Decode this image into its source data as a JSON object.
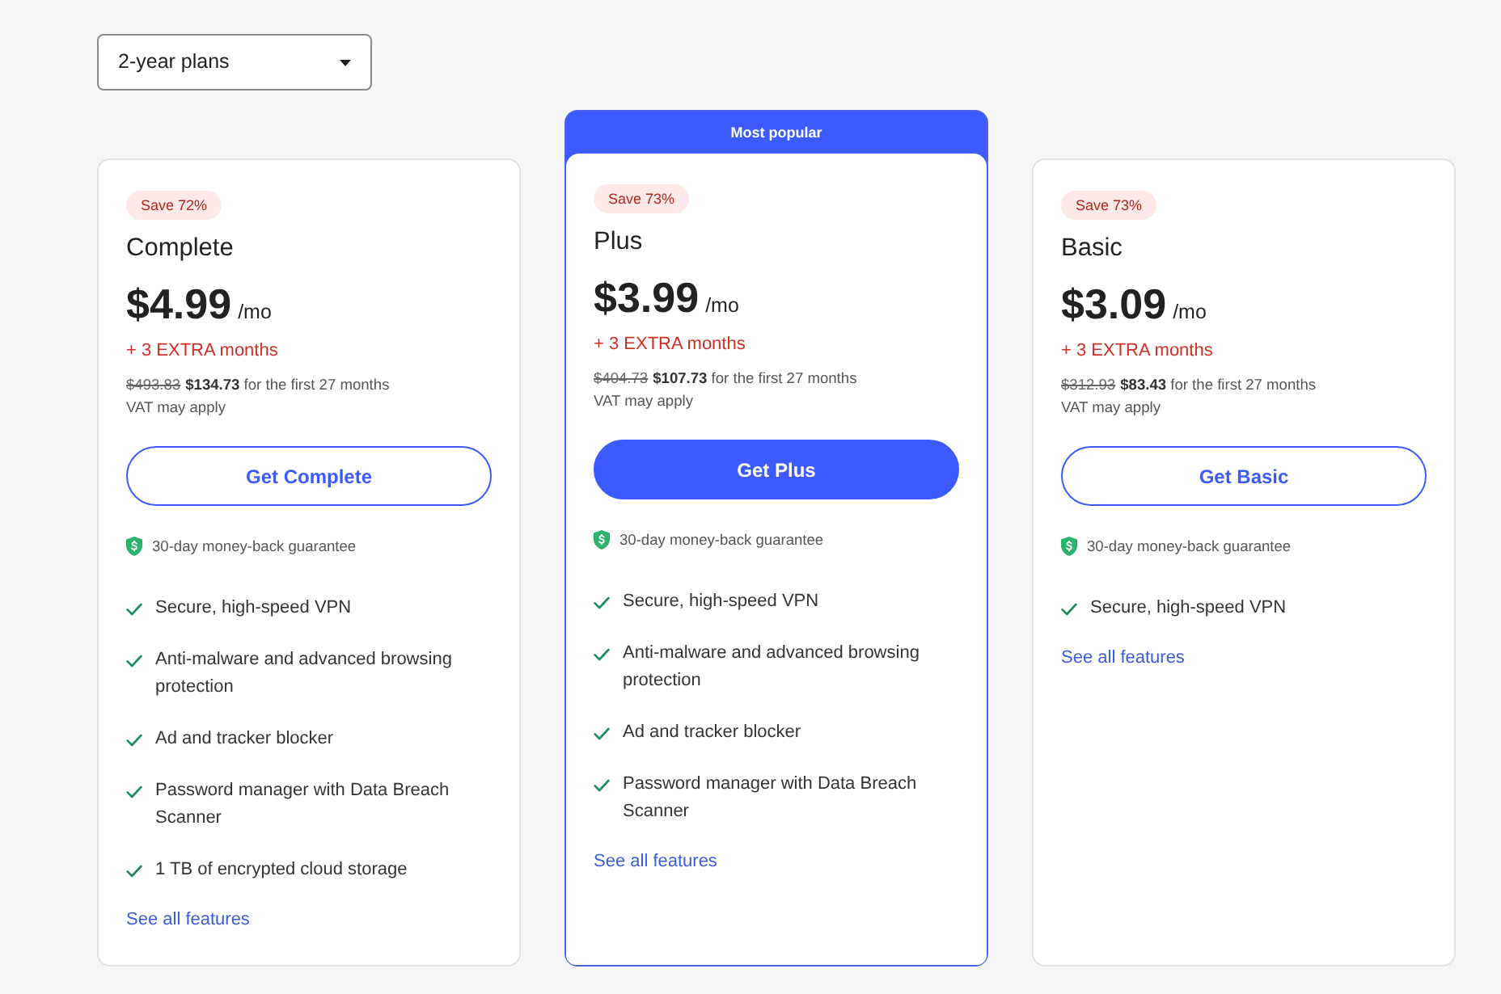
{
  "plan_selector": {
    "value": "2-year plans"
  },
  "plans": [
    {
      "featured": false,
      "badge": "Save 72%",
      "name": "Complete",
      "price": "$4.99",
      "period": "/mo",
      "extra": "+ 3 EXTRA months",
      "old_price": "$493.83",
      "price_note": "**$134.73** for the first 27 months",
      "vat": "VAT may apply",
      "button": "Get Complete",
      "guarantee": "30-day money-back guarantee",
      "features": [
        "Secure, high-speed VPN",
        "Anti-malware and advanced browsing protection",
        "Ad and tracker blocker",
        "Password manager with Data Breach Scanner",
        "1 TB of encrypted cloud storage"
      ],
      "link": "See all features"
    },
    {
      "ribbon": "Most popular",
      "featured": true,
      "badge": "Save 73%",
      "name": "Plus",
      "price": "$3.99",
      "period": "/mo",
      "extra": "+ 3 EXTRA months",
      "old_price": "$404.73",
      "price_note": "**$107.73** for the first 27 months",
      "vat": "VAT may apply",
      "button": "Get Plus",
      "guarantee": "30-day money-back guarantee",
      "features": [
        "Secure, high-speed VPN",
        "Anti-malware and advanced browsing protection",
        "Ad and tracker blocker",
        "Password manager with Data Breach Scanner"
      ],
      "link": "See all features"
    },
    {
      "featured": false,
      "badge": "Save 73%",
      "name": "Basic",
      "price": "$3.09",
      "period": "/mo",
      "extra": "+ 3 EXTRA months",
      "old_price": "$312.93",
      "price_note": "**$83.43** for the first 27 months",
      "vat": "VAT may apply",
      "button": "Get Basic",
      "guarantee": "30-day money-back guarantee",
      "features": [
        "Secure, high-speed VPN"
      ],
      "link": "See all features"
    }
  ]
}
